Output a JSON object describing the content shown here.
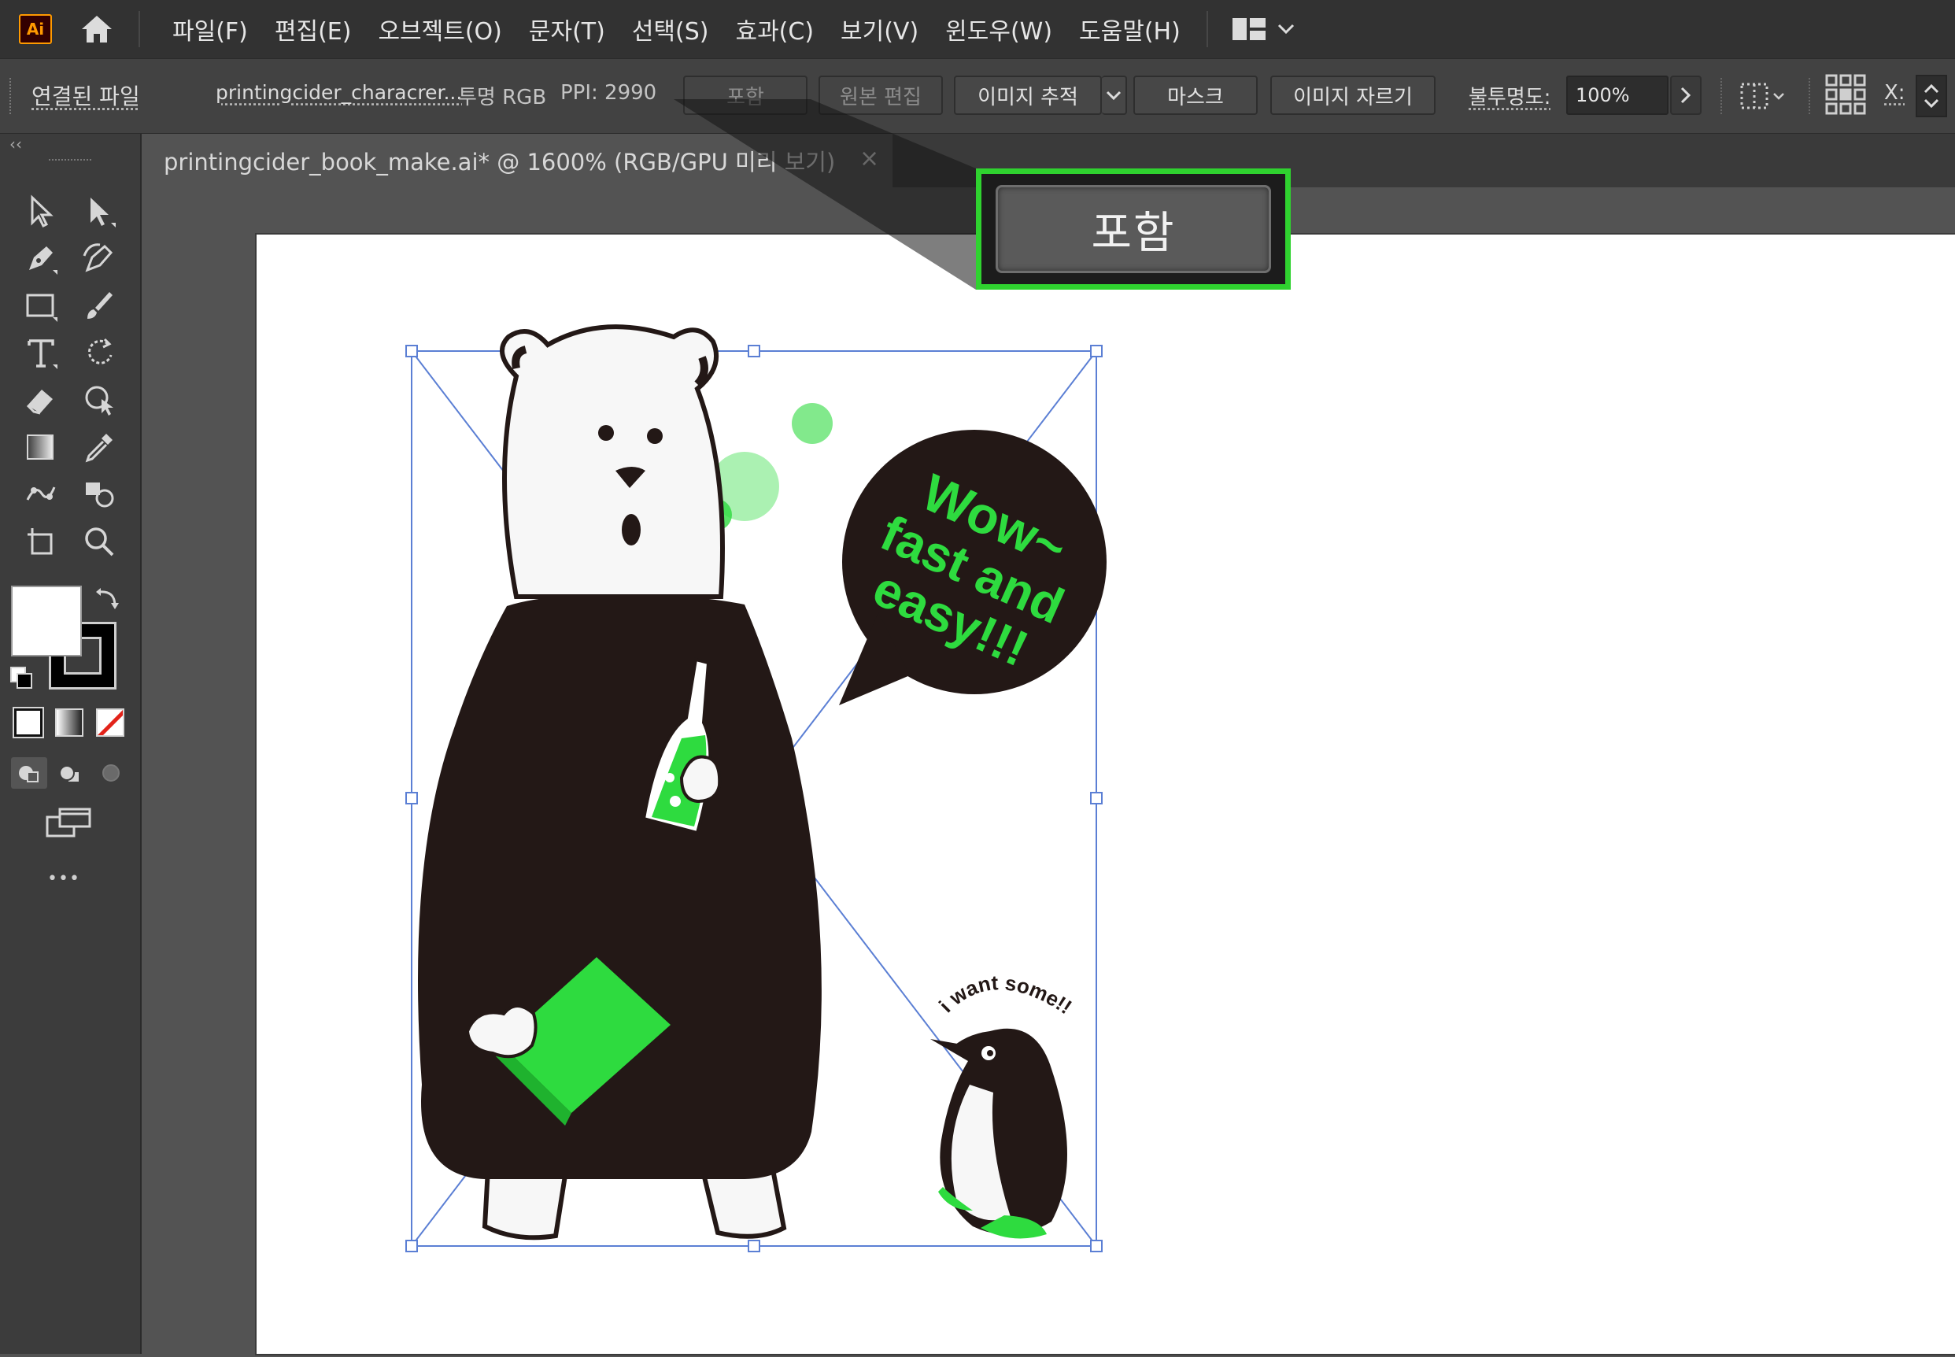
{
  "app": {
    "logo": "Ai",
    "accent_color": "#ff9a00",
    "highlight_color": "#2fd22f"
  },
  "menu": [
    "파일(F)",
    "편집(E)",
    "오브젝트(O)",
    "문자(T)",
    "선택(S)",
    "효과(C)",
    "보기(V)",
    "윈도우(W)",
    "도움말(H)"
  ],
  "control_bar": {
    "linked_file_label": "연결된 파일",
    "file_name": "printingcider_characrer...",
    "color_mode": "투명 RGB",
    "ppi": "PPI: 2990",
    "embed_label": "포함",
    "edit_original_label": "원본 편집",
    "image_trace_label": "이미지 추적",
    "mask_label": "마스크",
    "crop_image_label": "이미지 자르기",
    "opacity_label": "불투명도:",
    "opacity_value": "100%",
    "x_label": "X:"
  },
  "document": {
    "tab_title": "printingcider_book_make.ai*  @  1600%  (RGB/GPU 미리 보기)",
    "close": "×"
  },
  "toolbar": {
    "collapse": "‹‹",
    "more": "•••"
  },
  "artwork": {
    "bubble_line1": "Wow~",
    "bubble_line2": "fast and",
    "bubble_line3": "easy!!!",
    "penguin_text": "i want some!!",
    "green": "#2edb3f",
    "dark": "#231816"
  },
  "callout": {
    "label": "포함"
  }
}
